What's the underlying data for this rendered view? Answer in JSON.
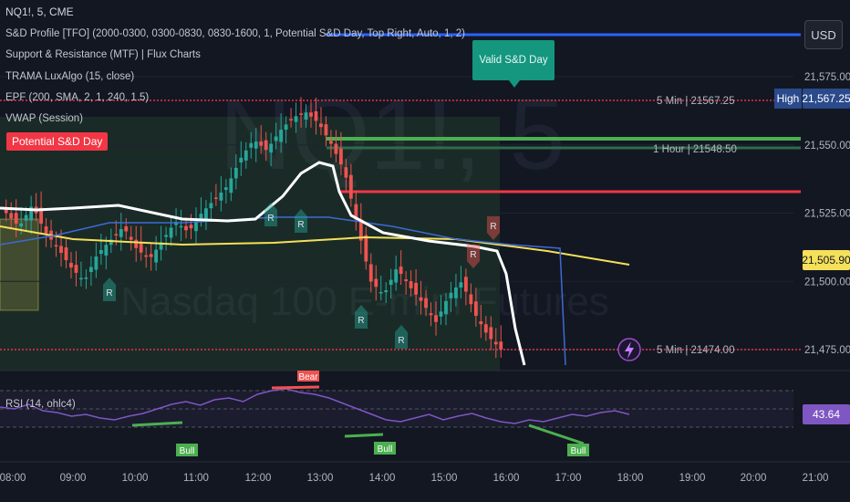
{
  "legend": {
    "symbol": "NQ1!, 5, CME",
    "indicators": [
      "S&D Profile [TFO] (2000-0300, 0300-0830, 0830-1600, 1, Potential S&D Day, Top Right, Auto, 1, 2)",
      "Support & Resistance (MTF) | Flux Charts",
      "TRAMA LuxAlgo (15, close)",
      "EPF (200, SMA, 2, 1, 240, 1.5)",
      "VWAP (Session)"
    ],
    "rsi": "RSI (14, ohlc4)"
  },
  "watermark": {
    "symbol": "NQ1!, 5",
    "name": "Nasdaq 100 E-mini Futures"
  },
  "currency": "USD",
  "annotations": {
    "valid_sd_day": "Valid S&D Day",
    "potential_sd_day": "Potential S&D Day",
    "high_label": "High",
    "level_5min_top": "5 Min | 21567.25",
    "level_1hour": "1 Hour | 21548.50",
    "level_5min_bottom": "5 Min | 21474.00",
    "bear_label": "Bear",
    "bull_label": "Bull",
    "retest_label": "R"
  },
  "price_tags": {
    "high": "21,567.25",
    "last": "21,505.90",
    "rsi": "43.64"
  },
  "colors": {
    "background": "#131722",
    "bull": "#26a69a",
    "bear": "#ef5350",
    "support": "#4caf50",
    "resistance": "#f23645",
    "vwap": "#f5e05a",
    "blue": "#2962ff",
    "rsi": "#7e57c2",
    "trama": "#ffffff"
  },
  "chart_data": {
    "type": "candlestick",
    "x_ticks": [
      "08:00",
      "09:00",
      "10:00",
      "11:00",
      "12:00",
      "13:00",
      "14:00",
      "15:00",
      "16:00",
      "17:00",
      "18:00",
      "19:00",
      "20:00",
      "21:00"
    ],
    "y_ticks": [
      21575.0,
      21550.0,
      21525.0,
      21500.0,
      21475.0
    ],
    "y_tick_labels": [
      "21,575.00",
      "21,550.00",
      "21,525.00",
      "21,500.00",
      "21,475.00"
    ],
    "ylim": [
      21465.0,
      21590.0
    ],
    "candles_close_approx": [
      21525,
      21520,
      21528,
      21518,
      21512,
      21505,
      21500,
      21510,
      21515,
      21520,
      21512,
      21508,
      21515,
      21522,
      21518,
      21525,
      21530,
      21535,
      21545,
      21552,
      21548,
      21555,
      21560,
      21562,
      21558,
      21550,
      21540,
      21520,
      21500,
      21495,
      21505,
      21498,
      21492,
      21485,
      21495,
      21500,
      21488,
      21480,
      21475
    ],
    "levels": [
      {
        "label": "5 Min | 21567.25",
        "value": 21567.25
      },
      {
        "label": "1 Hour | 21548.50",
        "value": 21548.5
      },
      {
        "label": "5 Min | 21474.00",
        "value": 21474.0
      }
    ],
    "last_price": 21505.9,
    "rsi": {
      "last": 43.64,
      "values_approx": [
        52,
        50,
        55,
        48,
        46,
        42,
        44,
        40,
        38,
        42,
        45,
        50,
        55,
        58,
        54,
        60,
        62,
        58,
        66,
        70,
        72,
        68,
        66,
        62,
        56,
        50,
        44,
        38,
        36,
        40,
        44,
        38,
        42,
        45,
        40,
        36,
        34,
        38,
        36,
        40,
        44,
        42,
        46,
        48,
        44
      ]
    }
  }
}
